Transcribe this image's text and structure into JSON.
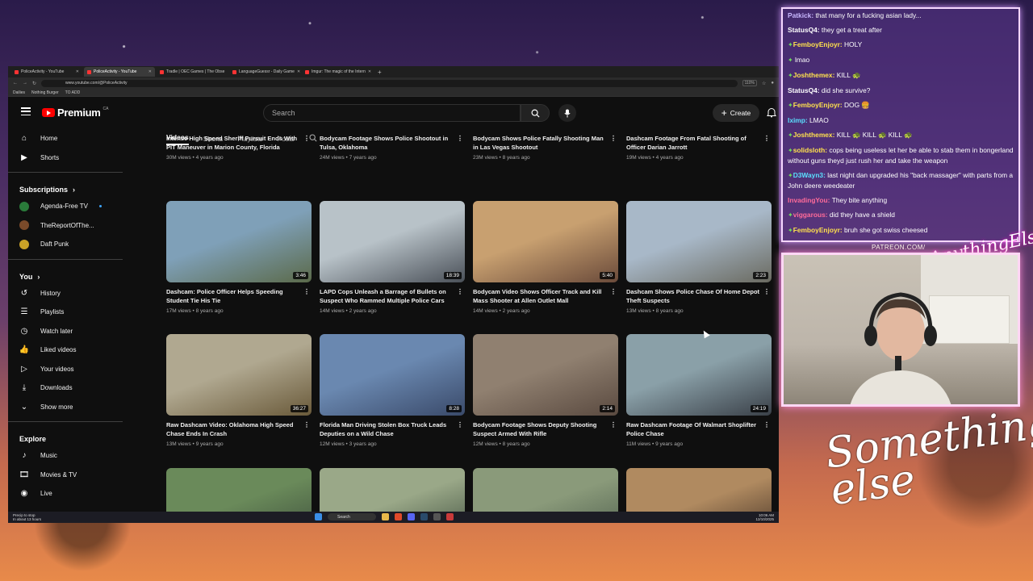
{
  "browser": {
    "tabs": [
      {
        "label": "PoliceActivity - YouTube",
        "active": false
      },
      {
        "label": "PoliceActivity - YouTube",
        "active": true
      },
      {
        "label": "Tradle | OEC Games | The Obse",
        "active": false
      },
      {
        "label": "LanguageGuessr - Daily Game",
        "active": false
      },
      {
        "label": "Imgur: The magic of the Intern",
        "active": false
      }
    ],
    "url": "www.youtube.com/@PoliceActivity",
    "zoom": "110%",
    "bookmarks": [
      "Dailies",
      "Nothing Burger",
      "TO ADD"
    ]
  },
  "youtube": {
    "logo_text": "Premium",
    "logo_country": "CA",
    "search_placeholder": "Search",
    "create_label": "Create",
    "channel_tabs": [
      "Videos",
      "Shorts",
      "Playlists",
      "Posts"
    ],
    "active_tab": "Videos",
    "sidebar": {
      "main": [
        {
          "label": "Home",
          "icon": "home-icon"
        },
        {
          "label": "Shorts",
          "icon": "shorts-icon"
        }
      ],
      "subscriptions_title": "Subscriptions",
      "subscriptions": [
        {
          "label": "Agenda-Free TV",
          "color": "#2a7a3a",
          "new": true
        },
        {
          "label": "TheReportOfThe...",
          "color": "#7a4a2a",
          "new": true
        },
        {
          "label": "Daft Punk",
          "color": "#c9a227",
          "new": false
        }
      ],
      "you_title": "You",
      "you": [
        {
          "label": "History",
          "icon": "history-icon"
        },
        {
          "label": "Playlists",
          "icon": "playlists-icon"
        },
        {
          "label": "Watch later",
          "icon": "clock-icon"
        },
        {
          "label": "Liked videos",
          "icon": "thumbs-up-icon"
        },
        {
          "label": "Your videos",
          "icon": "video-icon"
        },
        {
          "label": "Downloads",
          "icon": "download-icon"
        },
        {
          "label": "Show more",
          "icon": "chevron-down-icon"
        }
      ],
      "explore_title": "Explore",
      "explore": [
        {
          "label": "Music",
          "icon": "music-icon"
        },
        {
          "label": "Movies & TV",
          "icon": "film-icon"
        },
        {
          "label": "Live",
          "icon": "live-icon"
        }
      ]
    },
    "top_row": [
      {
        "title": "Intense High Speed Sheriff Pursuit Ends With PIT Maneuver in Marion County, Florida",
        "meta": "30M views • 4 years ago"
      },
      {
        "title": "Bodycam Footage Shows Police Shootout in Tulsa, Oklahoma",
        "meta": "24M views • 7 years ago"
      },
      {
        "title": "Bodycam Shows Police Fatally Shooting Man in Las Vegas Shootout",
        "meta": "23M views • 8 years ago"
      },
      {
        "title": "Dashcam Footage From Fatal Shooting of Officer Darian Jarrott",
        "meta": "19M views • 4 years ago"
      }
    ],
    "videos": [
      {
        "title": "Dashcam: Police Officer Helps Speeding Student Tie His Tie",
        "meta": "17M views • 8 years ago",
        "duration": "3:46",
        "c1": "#7fa0b8",
        "c2": "#5b6a4a"
      },
      {
        "title": "LAPD Cops Unleash a Barrage of Bullets on Suspect Who Rammed Multiple Police Cars",
        "meta": "14M views • 2 years ago",
        "duration": "18:39",
        "c1": "#b8c2c8",
        "c2": "#4a5058"
      },
      {
        "title": "Bodycam Video Shows Officer Track and Kill Mass Shooter at Allen Outlet Mall",
        "meta": "14M views • 2 years ago",
        "duration": "5:40",
        "c1": "#c8a070",
        "c2": "#6a4a3a"
      },
      {
        "title": "Dashcam Shows Police Chase Of Home Depot Theft Suspects",
        "meta": "13M views • 8 years ago",
        "duration": "2:23",
        "c1": "#a8b8c8",
        "c2": "#6a6a60"
      },
      {
        "title": "Raw Dashcam Video: Oklahoma High Speed Chase Ends In Crash",
        "meta": "13M views • 9 years ago",
        "duration": "36:27",
        "c1": "#b0a890",
        "c2": "#6a5a3a"
      },
      {
        "title": "Florida Man Driving Stolen Box Truck Leads Deputies on a Wild Chase",
        "meta": "12M views • 3 years ago",
        "duration": "8:28",
        "c1": "#6a88b0",
        "c2": "#3a4a6a"
      },
      {
        "title": "Bodycam Footage Shows Deputy Shooting Suspect Armed With Rifle",
        "meta": "12M views • 8 years ago",
        "duration": "2:14",
        "c1": "#908070",
        "c2": "#5a4a40"
      },
      {
        "title": "Raw Dashcam Footage Of Walmart Shoplifter Police Chase",
        "meta": "11M views • 9 years ago",
        "duration": "24:19",
        "c1": "#8aa0a8",
        "c2": "#3a4048"
      }
    ],
    "bottom_row_colors": [
      [
        "#6a8a5a",
        "#3a4a3a"
      ],
      [
        "#9aa888",
        "#3a4a3a"
      ],
      [
        "#8a9a7a",
        "#4a5a4a"
      ],
      [
        "#b08a60",
        "#3a2a20"
      ]
    ]
  },
  "taskbar": {
    "left": "Precip to stop\nIn about 13 hours",
    "search": "Search",
    "time": "10:06 AM\n12/10/2025"
  },
  "chat": {
    "messages": [
      {
        "user": "Patkick",
        "color": "#c9b8ff",
        "text": "that many for a fucking asian lady...",
        "badge": false
      },
      {
        "user": "StatusQ4",
        "color": "#ffffff",
        "text": "they get a treat after",
        "badge": false
      },
      {
        "user": "FemboyEnjoyr",
        "color": "#ffe14d",
        "text": "HOLY",
        "badge": true
      },
      {
        "user": "",
        "color": "#5aa0ff",
        "text": "lmao",
        "badge": true
      },
      {
        "user": "Joshthemex",
        "color": "#ffe14d",
        "text": "KILL 🐢",
        "badge": true
      },
      {
        "user": "StatusQ4",
        "color": "#ffffff",
        "text": "did she survive?",
        "badge": false
      },
      {
        "user": "FemboyEnjoyr",
        "color": "#ffe14d",
        "text": "DOG 🍔",
        "badge": true
      },
      {
        "user": "lximp",
        "color": "#5ae0ff",
        "text": "LMAO",
        "badge": false
      },
      {
        "user": "Joshthemex",
        "color": "#ffe14d",
        "text": "KILL 🐢 KILL 🐢 KILL 🐢",
        "badge": true
      },
      {
        "user": "solidsloth",
        "color": "#ffe14d",
        "text": "cops being useless let her be able to stab them in bongerland without guns theyd just rush her and take the weapon",
        "badge": true
      },
      {
        "user": "D3Wayn3",
        "color": "#5ae0ff",
        "text": "last night dan upgraded his \"back massager\" with parts from a John deere weedeater",
        "badge": true
      },
      {
        "user": "InvadingYou",
        "color": "#ff6b9a",
        "text": "They bite anything",
        "badge": false
      },
      {
        "user": "viggarous",
        "color": "#ff6b9a",
        "text": "did they have a shield",
        "badge": true
      },
      {
        "user": "FemboyEnjoyr",
        "color": "#ffe14d",
        "text": "bruh she got swiss cheesed",
        "badge": true
      }
    ]
  },
  "overlay": {
    "patreon": "PATREON.COM/",
    "anything": "AnythingElse",
    "brand": "Something else"
  }
}
